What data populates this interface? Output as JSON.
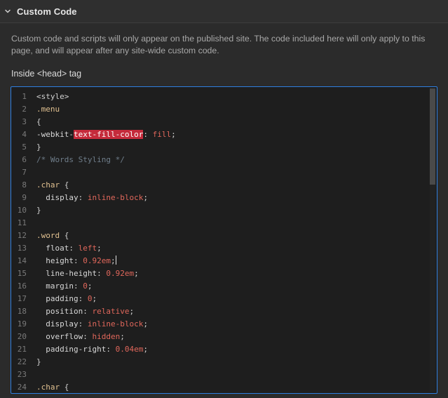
{
  "section": {
    "title": "Custom Code",
    "description": "Custom code and scripts will only appear on the published site. The code included here will only apply to this page, and will appear after any site-wide custom code.",
    "field_label": "Inside <head> tag"
  },
  "editor": {
    "lines": [
      {
        "n": "1",
        "tokens": [
          {
            "t": "<style>",
            "c": "tag"
          }
        ]
      },
      {
        "n": "2",
        "tokens": [
          {
            "t": ".menu",
            "c": "sel"
          }
        ]
      },
      {
        "n": "3",
        "tokens": [
          {
            "t": "{",
            "c": "pun"
          }
        ]
      },
      {
        "n": "4",
        "tokens": [
          {
            "t": "-webkit-",
            "c": "prop"
          },
          {
            "t": "text-fill-color",
            "c": "prop",
            "hl": true
          },
          {
            "t": ": ",
            "c": "pun"
          },
          {
            "t": "fill",
            "c": "val"
          },
          {
            "t": ";",
            "c": "pun"
          }
        ]
      },
      {
        "n": "5",
        "tokens": [
          {
            "t": "}",
            "c": "pun"
          }
        ]
      },
      {
        "n": "6",
        "tokens": [
          {
            "t": "/* Words Styling */",
            "c": "com"
          }
        ]
      },
      {
        "n": "7",
        "tokens": []
      },
      {
        "n": "8",
        "tokens": [
          {
            "t": ".char",
            "c": "sel"
          },
          {
            "t": " {",
            "c": "pun"
          }
        ]
      },
      {
        "n": "9",
        "tokens": [
          {
            "t": "  display",
            "c": "prop"
          },
          {
            "t": ": ",
            "c": "pun"
          },
          {
            "t": "inline-block",
            "c": "val"
          },
          {
            "t": ";",
            "c": "pun"
          }
        ]
      },
      {
        "n": "10",
        "tokens": [
          {
            "t": "}",
            "c": "pun"
          }
        ]
      },
      {
        "n": "11",
        "tokens": []
      },
      {
        "n": "12",
        "tokens": [
          {
            "t": ".word",
            "c": "sel"
          },
          {
            "t": " {",
            "c": "pun"
          }
        ]
      },
      {
        "n": "13",
        "tokens": [
          {
            "t": "  float",
            "c": "prop"
          },
          {
            "t": ": ",
            "c": "pun"
          },
          {
            "t": "left",
            "c": "val"
          },
          {
            "t": ";",
            "c": "pun"
          }
        ]
      },
      {
        "n": "14",
        "tokens": [
          {
            "t": "  height",
            "c": "prop"
          },
          {
            "t": ": ",
            "c": "pun"
          },
          {
            "t": "0.92em",
            "c": "val"
          },
          {
            "t": ";",
            "c": "pun"
          }
        ],
        "caret": true
      },
      {
        "n": "15",
        "tokens": [
          {
            "t": "  line-height",
            "c": "prop"
          },
          {
            "t": ": ",
            "c": "pun"
          },
          {
            "t": "0.92em",
            "c": "val"
          },
          {
            "t": ";",
            "c": "pun"
          }
        ]
      },
      {
        "n": "16",
        "tokens": [
          {
            "t": "  margin",
            "c": "prop"
          },
          {
            "t": ": ",
            "c": "pun"
          },
          {
            "t": "0",
            "c": "val"
          },
          {
            "t": ";",
            "c": "pun"
          }
        ]
      },
      {
        "n": "17",
        "tokens": [
          {
            "t": "  padding",
            "c": "prop"
          },
          {
            "t": ": ",
            "c": "pun"
          },
          {
            "t": "0",
            "c": "val"
          },
          {
            "t": ";",
            "c": "pun"
          }
        ]
      },
      {
        "n": "18",
        "tokens": [
          {
            "t": "  position",
            "c": "prop"
          },
          {
            "t": ": ",
            "c": "pun"
          },
          {
            "t": "relative",
            "c": "val"
          },
          {
            "t": ";",
            "c": "pun"
          }
        ]
      },
      {
        "n": "19",
        "tokens": [
          {
            "t": "  display",
            "c": "prop"
          },
          {
            "t": ": ",
            "c": "pun"
          },
          {
            "t": "inline-block",
            "c": "val"
          },
          {
            "t": ";",
            "c": "pun"
          }
        ]
      },
      {
        "n": "20",
        "tokens": [
          {
            "t": "  overflow",
            "c": "prop"
          },
          {
            "t": ": ",
            "c": "pun"
          },
          {
            "t": "hidden",
            "c": "val"
          },
          {
            "t": ";",
            "c": "pun"
          }
        ]
      },
      {
        "n": "21",
        "tokens": [
          {
            "t": "  padding-right",
            "c": "prop"
          },
          {
            "t": ": ",
            "c": "pun"
          },
          {
            "t": "0.04em",
            "c": "val"
          },
          {
            "t": ";",
            "c": "pun"
          }
        ]
      },
      {
        "n": "22",
        "tokens": [
          {
            "t": "}",
            "c": "pun"
          }
        ]
      },
      {
        "n": "23",
        "tokens": []
      },
      {
        "n": "24",
        "tokens": [
          {
            "t": ".char",
            "c": "sel"
          },
          {
            "t": " {",
            "c": "pun"
          }
        ]
      }
    ]
  },
  "colors": {
    "focus_border": "#2f7fe0",
    "highlight": "#c52b3b",
    "value": "#e0675b"
  },
  "icons": {
    "collapse": "chevron-down-icon"
  }
}
